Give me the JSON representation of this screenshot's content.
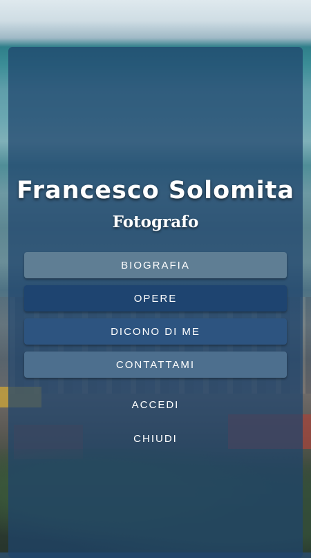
{
  "header": {
    "name": "Francesco Solomita",
    "role": "Fotografo"
  },
  "menu": {
    "items": [
      {
        "label": "BIOGRAFIA"
      },
      {
        "label": "OPERE"
      },
      {
        "label": "DICONO DI ME"
      },
      {
        "label": "CONTATTAMI"
      }
    ],
    "links": [
      {
        "label": "ACCEDI"
      },
      {
        "label": "CHIUDI"
      }
    ]
  },
  "colors": {
    "panel": "#1e446c",
    "button_active": "#1e4470",
    "button_light": "#5f7e94"
  }
}
